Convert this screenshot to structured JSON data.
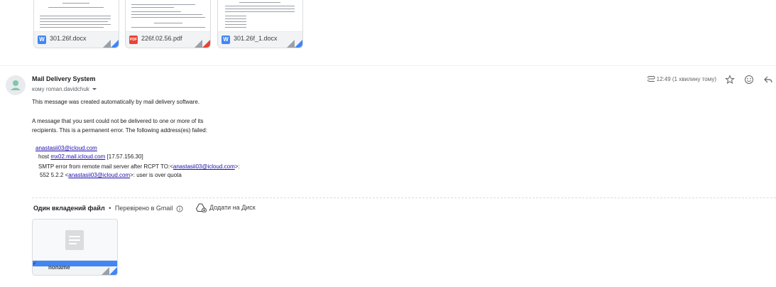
{
  "attachments_top": [
    {
      "name": "301.26f.docx",
      "type": "word",
      "badge": "W"
    },
    {
      "name": "226f.02.56.pdf",
      "type": "pdf",
      "badge": "PDF"
    },
    {
      "name": "301.26f_1.docx",
      "type": "word",
      "badge": "W"
    }
  ],
  "email": {
    "sender": "Mail Delivery System",
    "to": "кому roman.davidchuk",
    "time": "12:49 (1 хвилину тому)",
    "body": {
      "line1": "This message was created automatically by mail delivery software.",
      "line2": "A message that you sent could not be delivered to one or more of its",
      "line3": "recipients. This is a permanent error. The following address(es) failed:",
      "failed_address": "anastasii03@icloud.com",
      "host_prefix": "host",
      "host_link": "mx02.mail.icloud.com",
      "host_ip": "[17.57.156.30]",
      "smtp_prefix": "SMTP error from remote mail server after RCPT TO:<",
      "smtp_link": "anastasii03@icloud.com",
      "smtp_suffix": ">:",
      "code_prefix": "552 5.2.2 <",
      "code_link": "anastasii03@icloud.com",
      "code_suffix": ">: user is over quota"
    }
  },
  "attachment_section": {
    "count_label": "Один вкладений файл",
    "separator": "•",
    "checked_label": "Перевірено в Gmail",
    "drive_label": "Додати на Диск",
    "file": {
      "name": "noname",
      "badge": "✓"
    }
  },
  "colors": {
    "word": "#4285f4",
    "pdf": "#ea4335",
    "link": "#1a0dab",
    "avatar_person": "#7ec8a9"
  },
  "icons": [
    "paperclip-icon",
    "star-icon",
    "emoji-icon",
    "reply-icon",
    "info-icon",
    "drive-add-icon",
    "document-icon",
    "person-icon"
  ]
}
